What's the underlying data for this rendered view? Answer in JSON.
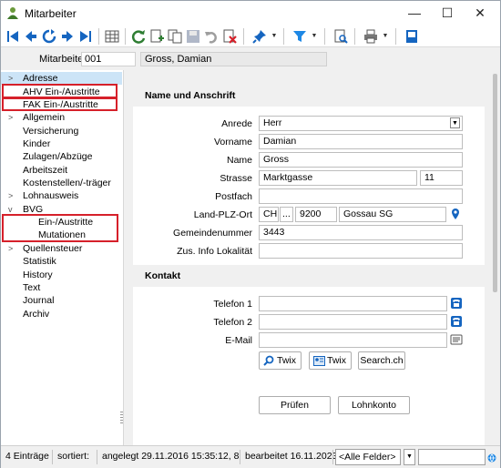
{
  "window": {
    "title": "Mitarbeiter"
  },
  "header": {
    "label": "Mitarbeiter",
    "number": "001",
    "name": "Gross, Damian"
  },
  "sidebar": {
    "items": [
      {
        "label": "Adresse",
        "arrow": ">",
        "selected": true
      },
      {
        "label": "AHV Ein-/Austritte",
        "arrow": ""
      },
      {
        "label": "FAK Ein-/Austritte",
        "arrow": ""
      },
      {
        "label": "Allgemein",
        "arrow": ">"
      },
      {
        "label": "Versicherung",
        "arrow": ""
      },
      {
        "label": "Kinder",
        "arrow": ""
      },
      {
        "label": "Zulagen/Abzüge",
        "arrow": ""
      },
      {
        "label": "Arbeitszeit",
        "arrow": ""
      },
      {
        "label": "Kostenstellen/-träger",
        "arrow": ""
      },
      {
        "label": "Lohnausweis",
        "arrow": ">"
      },
      {
        "label": "BVG",
        "arrow": "v"
      },
      {
        "label": "Ein-/Austritte",
        "arrow": ""
      },
      {
        "label": "Mutationen",
        "arrow": ""
      },
      {
        "label": "Quellensteuer",
        "arrow": ">"
      },
      {
        "label": "Statistik",
        "arrow": ""
      },
      {
        "label": "History",
        "arrow": ""
      },
      {
        "label": "Text",
        "arrow": ""
      },
      {
        "label": "Journal",
        "arrow": ""
      },
      {
        "label": "Archiv",
        "arrow": ""
      }
    ]
  },
  "address": {
    "section_title": "Name und Anschrift",
    "anrede_label": "Anrede",
    "anrede_value": "Herr",
    "vorname_label": "Vorname",
    "vorname_value": "Damian",
    "name_label": "Name",
    "name_value": "Gross",
    "strasse_label": "Strasse",
    "strasse_value": "Marktgasse",
    "hausnr_value": "11",
    "postfach_label": "Postfach",
    "postfach_value": "",
    "lpo_label": "Land-PLZ-Ort",
    "land_value": "CH",
    "lookup_label": "...",
    "plz_value": "9200",
    "ort_value": "Gossau SG",
    "gemeinde_label": "Gemeindenummer",
    "gemeinde_value": "3443",
    "zus_label": "Zus. Info Lokalität",
    "zus_value": ""
  },
  "contact": {
    "section_title": "Kontakt",
    "tel1_label": "Telefon 1",
    "tel1_value": "",
    "tel2_label": "Telefon 2",
    "tel2_value": "",
    "email_label": "E-Mail",
    "email_value": "",
    "twix1_label": "Twix",
    "twix2_label": "Twix",
    "search_label": "Search.ch"
  },
  "actions": {
    "pruefen_label": "Prüfen",
    "lohnkonto_label": "Lohnkonto"
  },
  "status": {
    "count": "4 Einträge",
    "sorted": "sortiert:",
    "created": "angelegt 29.11.2016 15:35:12, 8",
    "edited": "bearbeitet 16.11.2023",
    "filter": "<Alle Felder>"
  },
  "colors": {
    "accent": "#1565c0",
    "highlight": "#d6202a",
    "selected": "#cce4f7"
  }
}
